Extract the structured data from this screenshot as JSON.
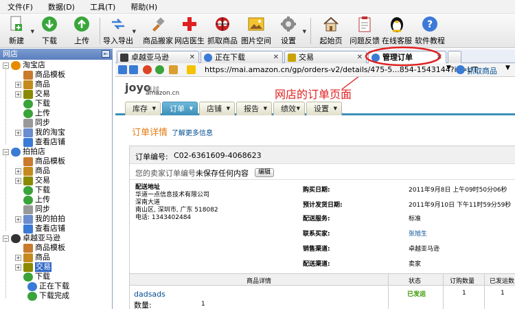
{
  "menu": [
    "文件(F)",
    "数据(D)",
    "工具(T)",
    "帮助(H)"
  ],
  "toolbar": {
    "new": "新建",
    "download": "下载",
    "upload": "上传",
    "import_export": "导入导出",
    "product_move": "商品搬家",
    "shop_doctor": "网店医生",
    "grab_product": "抓取商品",
    "image_space": "图片空间",
    "settings": "设置",
    "home": "起始页",
    "feedback": "问题反馈",
    "online_support": "在线客服",
    "tutorial": "软件教程"
  },
  "sidebar": {
    "title": "网店",
    "stores": [
      {
        "name": "淘宝店",
        "items": [
          "商品模板",
          "商品",
          "交易",
          "下载",
          "上传",
          "同步",
          "我的淘宝",
          "查看店铺"
        ]
      },
      {
        "name": "拍拍店",
        "items": [
          "商品模板",
          "商品",
          "交易",
          "下载",
          "上传",
          "同步",
          "我的拍拍",
          "查看店铺"
        ]
      },
      {
        "name": "卓越亚马逊",
        "items": [
          "商品模板",
          "商品",
          "交易",
          "下载"
        ],
        "sub": [
          "正在下载",
          "下载完成"
        ]
      }
    ]
  },
  "tabs": [
    "卓越亚马逊",
    "正在下载",
    "交易",
    "管理订单"
  ],
  "address": {
    "url": "https://mai.amazon.cn/gp/orders-v2/details/475-5...854-1543144?ie=UT",
    "grab": "抓取商品"
  },
  "page": {
    "logo": "joyo",
    "logo_cn": "卓越",
    "logo_sub": "amazon.cn",
    "annotation": "网店的订单页面",
    "nav": [
      "库存",
      "订单",
      "店铺",
      "报告",
      "绩效",
      "设置"
    ],
    "title": "订单详情",
    "more": "了解更多信息",
    "order_no_label": "订单编号:",
    "order_no": "C02-6361609-4068623",
    "seller_no_label": "您的卖家订单编号:",
    "seller_no": "未保存任何内容",
    "edit": "编辑",
    "ship_label": "配送地址",
    "ship_lines": [
      "华道一点信息技术有限公司",
      "深南大道",
      "南山区, 深圳市, 广东 518082",
      "电话: 1343402484"
    ],
    "rows": [
      {
        "label": "购买日期:",
        "value": "2011年9月8日 上午09时50分06秒"
      },
      {
        "label": "预计发货日期:",
        "value": "2011年9月10日 下午11时59分59秒"
      },
      {
        "label": "配送服务:",
        "value": "标准"
      },
      {
        "label": "联系买家:",
        "value": "张旭生"
      },
      {
        "label": "销售渠道:",
        "value": "卓越亚马逊"
      },
      {
        "label": "配送渠道:",
        "value": "卖家"
      }
    ],
    "table_headers": [
      "商品详情",
      "状态",
      "订购数量",
      "已发运数"
    ],
    "item_name": "dadsads",
    "item_status": "已发运",
    "item_ordered": "1",
    "item_shipped": "1",
    "qty_label": "数量:",
    "qty_value": "1"
  }
}
